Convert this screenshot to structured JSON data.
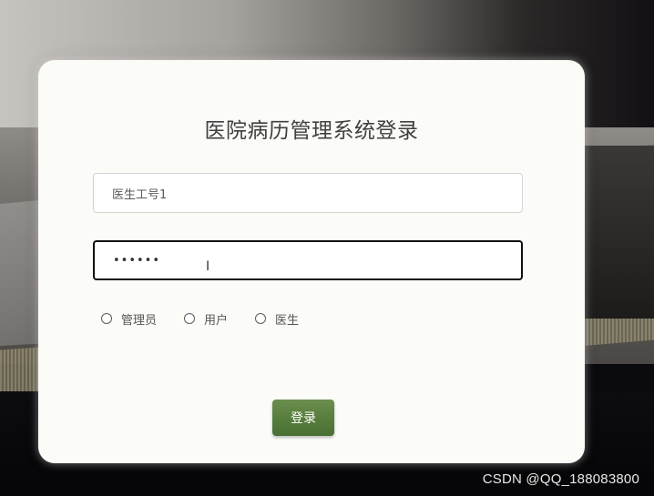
{
  "page": {
    "title": "医院病历管理系统登录"
  },
  "login_form": {
    "username_value": "医生工号1",
    "password_value": "••••••"
  },
  "roles": [
    {
      "label": "管理员",
      "selected": false
    },
    {
      "label": "用户",
      "selected": false
    },
    {
      "label": "医生",
      "selected": false
    }
  ],
  "actions": {
    "login_label": "登录"
  },
  "watermark": "CSDN @QQ_188083800",
  "colors": {
    "login_button": "#4f7636",
    "card_background": "#fbfbf8"
  }
}
